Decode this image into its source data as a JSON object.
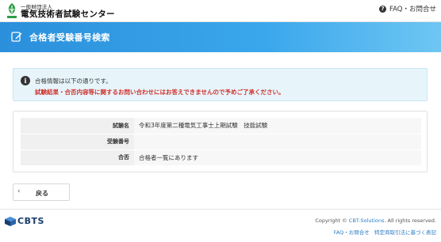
{
  "header": {
    "org_small": "一般財団法人",
    "org_name": "電気技術者試験センター",
    "faq_label": "FAQ・お問合せ"
  },
  "title_bar": {
    "title": "合格者受験番号検索"
  },
  "info": {
    "line1": "合格情報は以下の通りです。",
    "line2": "試験結果・合否内容等に関するお問い合わせにはお答えできませんので予めご了承ください。"
  },
  "result": {
    "rows": [
      {
        "label": "試験名",
        "value": "令和3年度第二種電気工事士上期試験　技能試験"
      },
      {
        "label": "受験番号",
        "value": ""
      },
      {
        "label": "合否",
        "value": "合格者一覧にあります"
      }
    ]
  },
  "back_button": {
    "label": "戻る"
  },
  "footer": {
    "brand": "CBTS",
    "copyright_prefix": "Copyright © ",
    "copyright_link": "CBT-Solutions",
    "copyright_suffix": ". All rights reserved.",
    "faq_link": "FAQ・お問合せ",
    "legal_link": "特定商取引法に基づく表記"
  },
  "colors": {
    "title_bar": "#2b8fdb",
    "warning_text": "#d0312d",
    "link": "#2b7cc4",
    "info_background": "#e7f5fb"
  }
}
